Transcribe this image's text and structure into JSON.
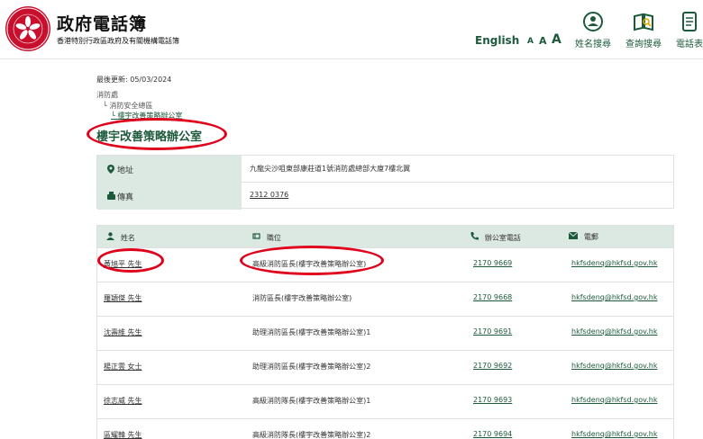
{
  "header": {
    "title": "政府電話簿",
    "subtitle": "香港特別行政區政府及有關機構電話簿",
    "language_label": "English",
    "font_sizes": [
      "A",
      "A",
      "A"
    ],
    "nav": [
      {
        "label": "姓名搜尋",
        "icon": "person-search-icon"
      },
      {
        "label": "查詢搜尋",
        "icon": "book-search-icon"
      },
      {
        "label": "電話表",
        "icon": "phone-list-icon"
      }
    ],
    "accent_color": "#1d5a3c",
    "brand_color": "#c8102e"
  },
  "page": {
    "last_updated": "最後更新: 05/03/2024",
    "breadcrumb": [
      "消防處",
      "消防安全總區",
      "樓宇改善策略辦公室"
    ],
    "title": "樓宇改善策略辦公室"
  },
  "info": {
    "address_label": "地址",
    "address_value": "九龍尖沙咀東部康莊道1號消防處總部大廈7樓北翼",
    "fax_label": "傳真",
    "fax_value": "2312 0376"
  },
  "table": {
    "headers": {
      "name": "姓名",
      "position": "職位",
      "tel": "辦公室電話",
      "email": "電郵"
    },
    "rows": [
      {
        "name": "黃旭平 先生",
        "position": "高級消防區長(樓宇改善策略辦公室)",
        "tel": "2170 9669",
        "email": "hkfsdenq@hkfsd.gov.hk"
      },
      {
        "name": "羅穎傑 先生",
        "position": "消防區長(樓宇改善策略辦公室)",
        "tel": "2170 9668",
        "email": "hkfsdenq@hkfsd.gov.hk"
      },
      {
        "name": "沈壽維 先生",
        "position": "助理消防區長(樓宇改善策略辦公室)1",
        "tel": "2170 9691",
        "email": "hkfsdenq@hkfsd.gov.hk"
      },
      {
        "name": "楊正雲 女士",
        "position": "助理消防區長(樓宇改善策略辦公室)2",
        "tel": "2170 9692",
        "email": "hkfsdenq@hkfsd.gov.hk"
      },
      {
        "name": "徐志威 先生",
        "position": "高級消防隊長(樓宇改善策略辦公室)1",
        "tel": "2170 9693",
        "email": "hkfsdenq@hkfsd.gov.hk"
      },
      {
        "name": "區耀韓 先生",
        "position": "高級消防隊長(樓宇改善策略辦公室)2",
        "tel": "2170 9694",
        "email": "hkfsdenq@hkfsd.gov.hk"
      }
    ]
  }
}
